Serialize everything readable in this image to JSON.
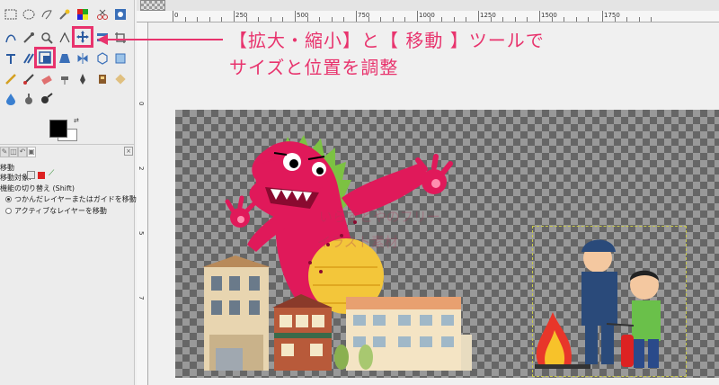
{
  "toolbox": {
    "tool_options": {
      "title": "移動",
      "move_target_label": "移動対象:",
      "toggle_label": "機能の切り替え (Shift)",
      "option_1": "つかんだレイヤーまたはガイドを移動",
      "option_2": "アクティブなレイヤーを移動"
    }
  },
  "ruler": {
    "top_labels": [
      "0",
      "250",
      "500",
      "750",
      "1000",
      "1250",
      "1500",
      "1750"
    ],
    "left_labels": [
      "0",
      "2",
      "5",
      "7"
    ]
  },
  "annotation": {
    "line1": "【拡大・縮小】と【 移動 】ツールで",
    "line2": "サイズと位置を調整",
    "color": "#e8336d"
  },
  "watermark": {
    "line1": "いらすとやのフリー",
    "line2": "イラスト素材"
  },
  "colors": {
    "accent": "#e8336d",
    "foreground": "#000000",
    "background": "#ffffff"
  }
}
